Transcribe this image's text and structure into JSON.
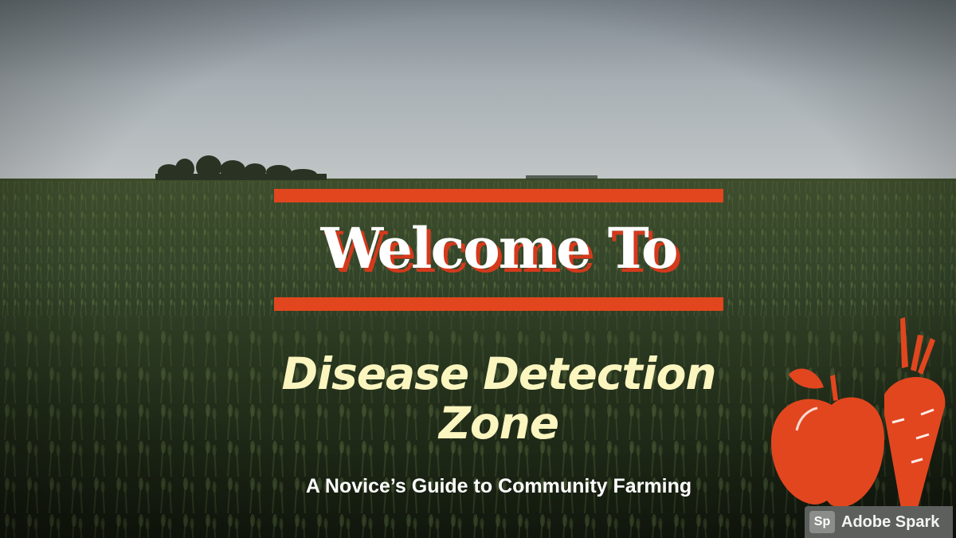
{
  "slide": {
    "heading": "Welcome To",
    "title": "Disease Detection Zone",
    "subtitle": "A Novice’s Guide to Community Farming"
  },
  "background": {
    "image": "wheat field under cloudy sky",
    "sky_color": "#a9b2b7",
    "field_color": "#2c3a1c"
  },
  "colors": {
    "accent": "#e2461f",
    "title_color": "#fbf5bf",
    "heading_color": "#ffffff"
  },
  "decoration": {
    "icon": "apple-carrot-icon"
  },
  "badge": {
    "logo": "Sp",
    "label": "Adobe Spark"
  }
}
